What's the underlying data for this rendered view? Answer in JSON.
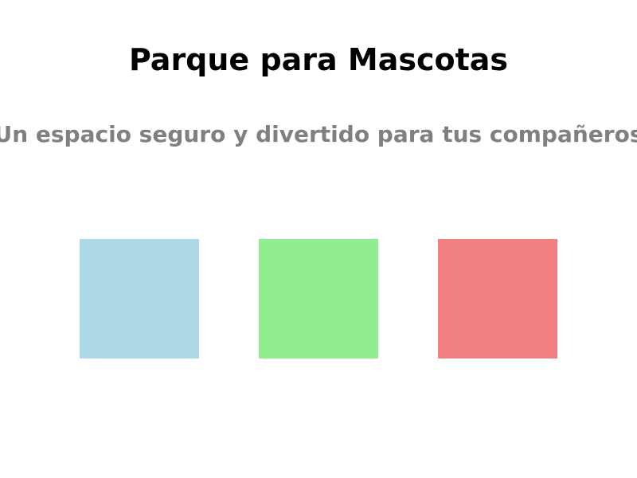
{
  "header": {
    "title": "Parque para Mascotas",
    "subtitle": "Un espacio seguro y divertido para tus compañeros"
  },
  "squares": [
    {
      "color": "#ADD8E6"
    },
    {
      "color": "#90EE90"
    },
    {
      "color": "#F08080"
    }
  ]
}
